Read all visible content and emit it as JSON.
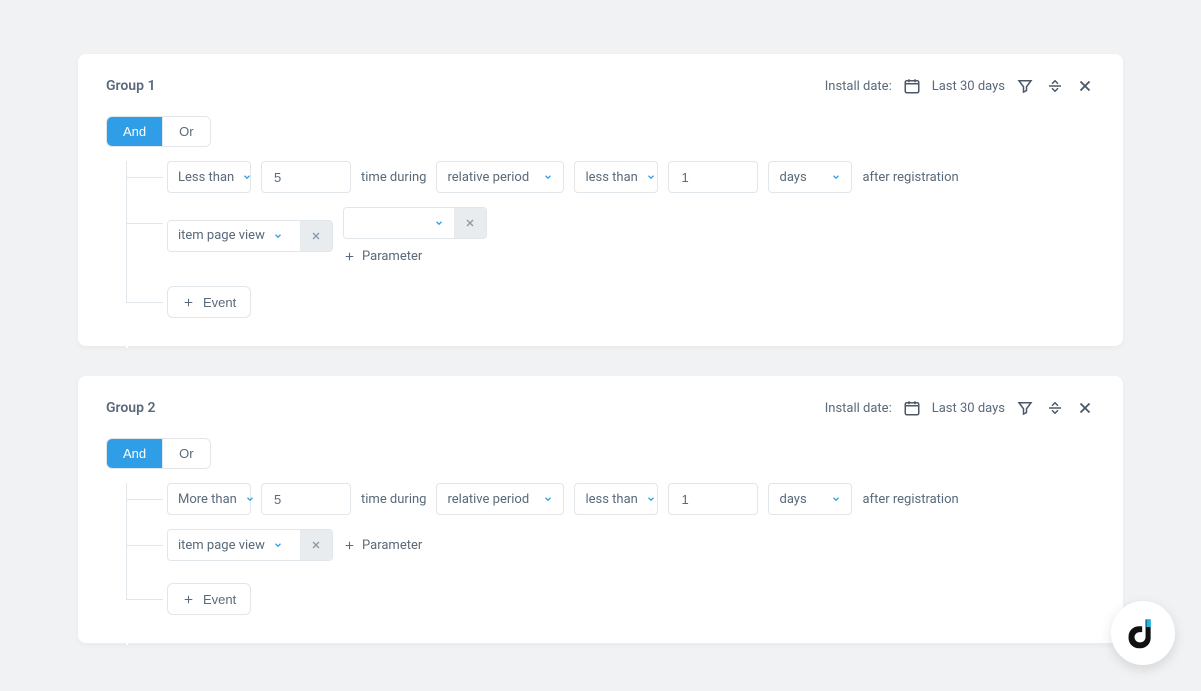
{
  "groups": [
    {
      "title": "Group 1",
      "install_label": "Install date:",
      "install_range": "Last 30 days",
      "logic": {
        "and": "And",
        "or": "Or",
        "active": "and"
      },
      "row1": {
        "comparison": "Less than",
        "count": "5",
        "time_during": "time during",
        "period_type": "relative period",
        "rel_comparison": "less than",
        "rel_value": "1",
        "rel_unit": "days",
        "after": "after registration"
      },
      "row2": {
        "event": "item page view",
        "param_value": "",
        "add_parameter": "Parameter"
      },
      "add_event": "Event"
    },
    {
      "title": "Group 2",
      "install_label": "Install date:",
      "install_range": "Last 30 days",
      "logic": {
        "and": "And",
        "or": "Or",
        "active": "and"
      },
      "row1": {
        "comparison": "More than",
        "count": "5",
        "time_during": "time during",
        "period_type": "relative period",
        "rel_comparison": "less than",
        "rel_value": "1",
        "rel_unit": "days",
        "after": "after registration"
      },
      "row2": {
        "event": "item page view",
        "add_parameter": "Parameter"
      },
      "add_event": "Event"
    }
  ]
}
